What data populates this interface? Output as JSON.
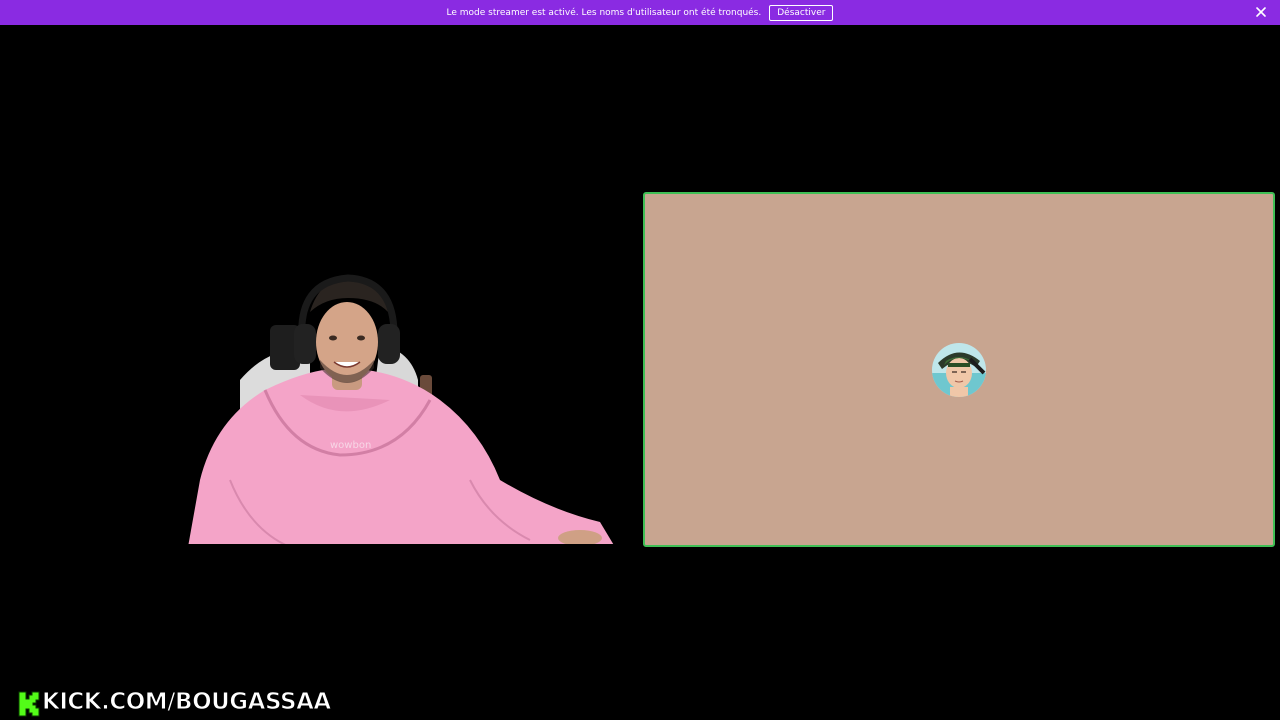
{
  "banner": {
    "message": "Le mode streamer est activé. Les noms d'utilisateur ont été tronqués.",
    "deactivate_label": "Désactiver",
    "close_icon": "close-icon",
    "background": "#8a2be2"
  },
  "call": {
    "tile_background": "#c8a590",
    "speaking_border": "#3fbf55",
    "avatar_icon": "user-avatar"
  },
  "overlay": {
    "logo_icon": "kick-logo-icon",
    "url_text": "KICK.COM/BOUGASSAA",
    "brand_color": "#53fc18"
  },
  "webcam": {
    "hoodie_color": "#f4a4c8",
    "hoodie_print": "wowbon"
  }
}
